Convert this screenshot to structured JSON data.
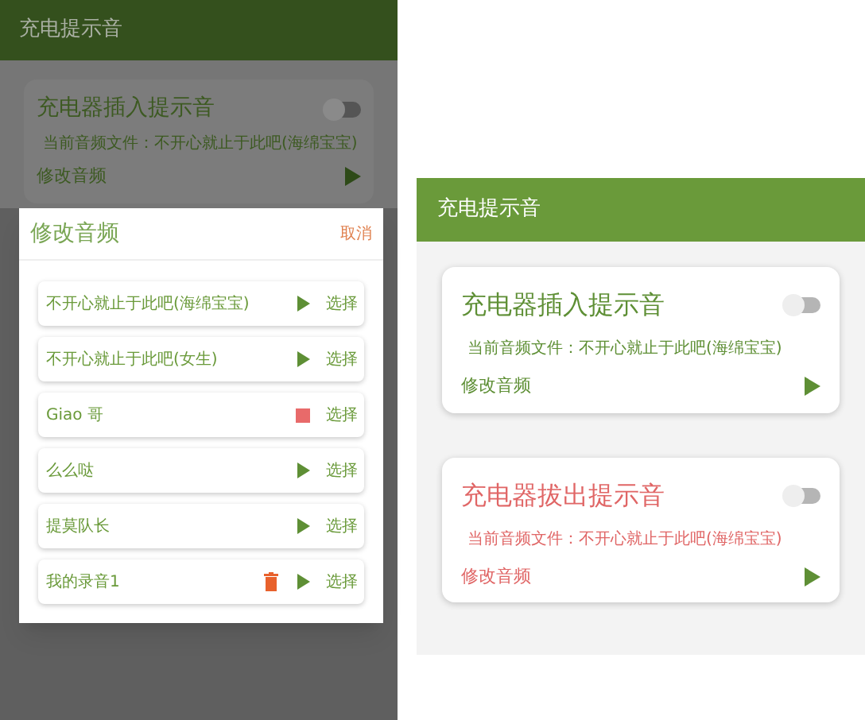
{
  "left_screen": {
    "app_bar": {
      "title": "充电提示音"
    },
    "cards": [
      {
        "title": "充电器插入提示音",
        "on": false,
        "file_text": "当前音频文件：不开心就止于此吧(海绵宝宝)",
        "change_label": "修改音频"
      }
    ],
    "dialog": {
      "title": "修改音频",
      "cancel": "取消",
      "items": [
        {
          "name": "不开心就止于此吧(海绵宝宝)",
          "playing": false,
          "deletable": false,
          "select": "选择"
        },
        {
          "name": "不开心就止于此吧(女生)",
          "playing": false,
          "deletable": false,
          "select": "选择"
        },
        {
          "name": "Giao 哥",
          "playing": true,
          "deletable": false,
          "select": "选择"
        },
        {
          "name": "么么哒",
          "playing": false,
          "deletable": false,
          "select": "选择"
        },
        {
          "name": "提莫队长",
          "playing": false,
          "deletable": false,
          "select": "选择"
        },
        {
          "name": "我的录音1",
          "playing": false,
          "deletable": true,
          "select": "选择"
        }
      ]
    }
  },
  "right_screen": {
    "app_bar": {
      "title": "充电提示音"
    },
    "cards": [
      {
        "title": "充电器插入提示音",
        "on": false,
        "color": "#5e8f35",
        "file_text": "当前音频文件：不开心就止于此吧(海绵宝宝)",
        "change_label": "修改音频"
      },
      {
        "title": "充电器拔出提示音",
        "on": false,
        "color": "#e06666",
        "file_text": "当前音频文件：不开心就止于此吧(海绵宝宝)",
        "change_label": "修改音频"
      }
    ]
  }
}
